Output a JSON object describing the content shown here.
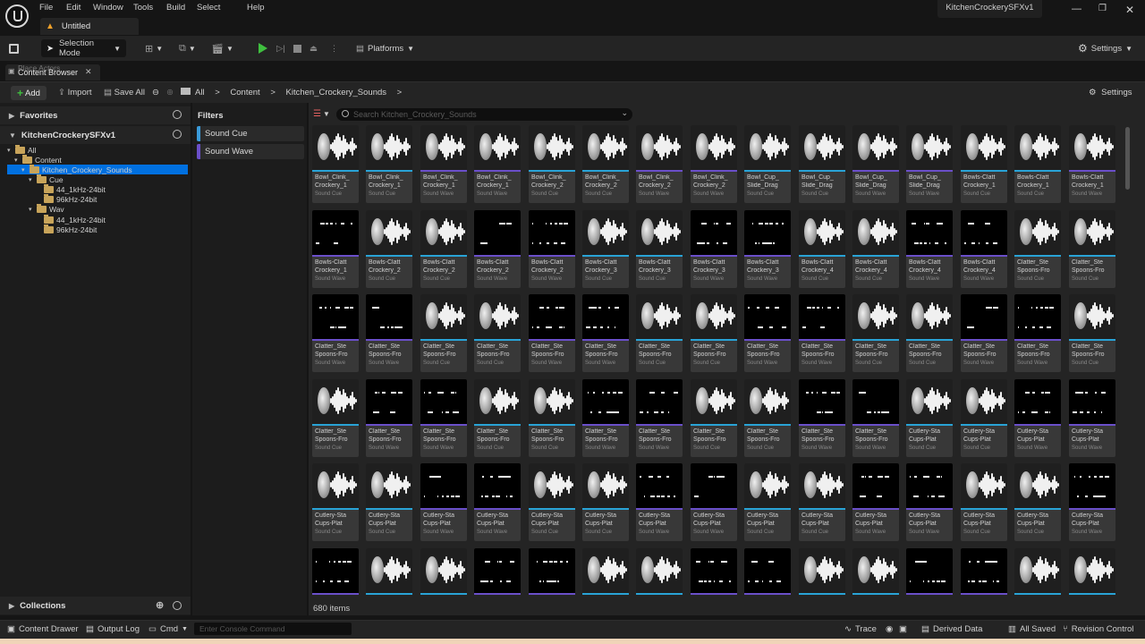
{
  "menu": [
    "File",
    "Edit",
    "Window",
    "Tools",
    "Build",
    "Select",
    "Help"
  ],
  "doc_tab": "Untitled",
  "project_name": "KitchenCrockerySFXv1",
  "toolbar": {
    "selection_mode": "Selection Mode",
    "platforms": "Platforms",
    "settings": "Settings"
  },
  "content_browser": {
    "ghost_tab": "Place Actors",
    "tab": "Content Browser",
    "add": "Add",
    "import": "Import",
    "save_all": "Save All",
    "breadcrumb": [
      "All",
      "Content",
      "Kitchen_Crockery_Sounds"
    ],
    "settings": "Settings"
  },
  "left": {
    "favorites": "Favorites",
    "project": "KitchenCrockerySFXv1",
    "collections": "Collections"
  },
  "tree": [
    {
      "label": "All",
      "level": 0
    },
    {
      "label": "Content",
      "level": 1
    },
    {
      "label": "Kitchen_Crockery_Sounds",
      "level": 2,
      "selected": true
    },
    {
      "label": "Cue",
      "level": 3
    },
    {
      "label": "44_1kHz-24bit",
      "level": 4
    },
    {
      "label": "96kHz-24bit",
      "level": 4
    },
    {
      "label": "Wav",
      "level": 3
    },
    {
      "label": "44_1kHz-24bit",
      "level": 4
    },
    {
      "label": "96kHz-24bit",
      "level": 4
    }
  ],
  "filters": {
    "title": "Filters",
    "items": [
      {
        "label": "Sound Cue",
        "color": "#3a9ad9"
      },
      {
        "label": "Sound Wave",
        "color": "#6a4fc9"
      }
    ]
  },
  "search_placeholder": "Search Kitchen_Crockery_Sounds",
  "item_count": "680 items",
  "type_labels": {
    "cue": "Sound Cue",
    "wave": "Sound Wave"
  },
  "type_colors": {
    "cue": "#29a3d6",
    "wave": "#6a4fc9"
  },
  "assets": [
    [
      [
        "Bowl_Clink_",
        "Crockery_1",
        0,
        0
      ],
      [
        "Bowl_Clink_",
        "Crockery_1",
        0,
        0
      ],
      [
        "Bowl_Clink_",
        "Crockery_1",
        0,
        1
      ],
      [
        "Bowl_Clink_",
        "Crockery_1",
        0,
        1
      ],
      [
        "Bowl_Clink_",
        "Crockery_2",
        0,
        0
      ],
      [
        "Bowl_Clink_",
        "Crockery_2",
        0,
        0
      ],
      [
        "Bowl_Clink_",
        "Crockery_2",
        0,
        1
      ],
      [
        "Bowl_Clink_",
        "Crockery_2",
        0,
        1
      ],
      [
        "Bowl_Cup_",
        "Slide_Drag",
        0,
        0
      ],
      [
        "Bowl_Cup_",
        "Slide_Drag",
        0,
        0
      ],
      [
        "Bowl_Cup_",
        "Slide_Drag",
        0,
        1
      ],
      [
        "Bowl_Cup_",
        "Slide_Drag",
        0,
        1
      ],
      [
        "Bowls-Clatt",
        "Crockery_1",
        0,
        0
      ],
      [
        "Bowls-Clatt",
        "Crockery_1",
        0,
        0
      ],
      [
        "Bowls-Clatt",
        "Crockery_1",
        0,
        1
      ]
    ],
    [
      [
        "Bowls-Clatt",
        "Crockery_1",
        1,
        1
      ],
      [
        "Bowls-Clatt",
        "Crockery_2",
        0,
        0
      ],
      [
        "Bowls-Clatt",
        "Crockery_2",
        0,
        0
      ],
      [
        "Bowls-Clatt",
        "Crockery_2",
        1,
        1
      ],
      [
        "Bowls-Clatt",
        "Crockery_2",
        1,
        1
      ],
      [
        "Bowls-Clatt",
        "Crockery_3",
        0,
        0
      ],
      [
        "Bowls-Clatt",
        "Crockery_3",
        0,
        0
      ],
      [
        "Bowls-Clatt",
        "Crockery_3",
        1,
        1
      ],
      [
        "Bowls-Clatt",
        "Crockery_3",
        1,
        1
      ],
      [
        "Bowls-Clatt",
        "Crockery_4",
        0,
        0
      ],
      [
        "Bowls-Clatt",
        "Crockery_4",
        0,
        0
      ],
      [
        "Bowls-Clatt",
        "Crockery_4",
        1,
        1
      ],
      [
        "Bowls-Clatt",
        "Crockery_4",
        1,
        1
      ],
      [
        "Clatter_Ste",
        "Spoons-Fro",
        0,
        0
      ],
      [
        "Clatter_Ste",
        "Spoons-Fro",
        0,
        0
      ]
    ],
    [
      [
        "Clatter_Ste",
        "Spoons-Fro",
        1,
        1
      ],
      [
        "Clatter_Ste",
        "Spoons-Fro",
        1,
        1
      ],
      [
        "Clatter_Ste",
        "Spoons-Fro",
        0,
        0
      ],
      [
        "Clatter_Ste",
        "Spoons-Fro",
        0,
        0
      ],
      [
        "Clatter_Ste",
        "Spoons-Fro",
        1,
        1
      ],
      [
        "Clatter_Ste",
        "Spoons-Fro",
        1,
        1
      ],
      [
        "Clatter_Ste",
        "Spoons-Fro",
        0,
        0
      ],
      [
        "Clatter_Ste",
        "Spoons-Fro",
        0,
        0
      ],
      [
        "Clatter_Ste",
        "Spoons-Fro",
        1,
        1
      ],
      [
        "Clatter_Ste",
        "Spoons-Fro",
        1,
        1
      ],
      [
        "Clatter_Ste",
        "Spoons-Fro",
        0,
        0
      ],
      [
        "Clatter_Ste",
        "Spoons-Fro",
        0,
        0
      ],
      [
        "Clatter_Ste",
        "Spoons-Fro",
        1,
        1
      ],
      [
        "Clatter_Ste",
        "Spoons-Fro",
        1,
        1
      ],
      [
        "Clatter_Ste",
        "Spoons-Fro",
        0,
        0
      ]
    ],
    [
      [
        "Clatter_Ste",
        "Spoons-Fro",
        0,
        0
      ],
      [
        "Clatter_Ste",
        "Spoons-Fro",
        1,
        1
      ],
      [
        "Clatter_Ste",
        "Spoons-Fro",
        1,
        1
      ],
      [
        "Clatter_Ste",
        "Spoons-Fro",
        0,
        0
      ],
      [
        "Clatter_Ste",
        "Spoons-Fro",
        0,
        0
      ],
      [
        "Clatter_Ste",
        "Spoons-Fro",
        1,
        1
      ],
      [
        "Clatter_Ste",
        "Spoons-Fro",
        1,
        1
      ],
      [
        "Clatter_Ste",
        "Spoons-Fro",
        0,
        0
      ],
      [
        "Clatter_Ste",
        "Spoons-Fro",
        0,
        0
      ],
      [
        "Clatter_Ste",
        "Spoons-Fro",
        1,
        1
      ],
      [
        "Clatter_Ste",
        "Spoons-Fro",
        1,
        1
      ],
      [
        "Cutlery-Sta",
        "Cups-Plat",
        0,
        0
      ],
      [
        "Cutlery-Sta",
        "Cups-Plat",
        0,
        0
      ],
      [
        "Cutlery-Sta",
        "Cups-Plat",
        1,
        1
      ],
      [
        "Cutlery-Sta",
        "Cups-Plat",
        1,
        1
      ]
    ],
    [
      [
        "Cutlery-Sta",
        "Cups-Plat",
        0,
        0
      ],
      [
        "Cutlery-Sta",
        "Cups-Plat",
        0,
        0
      ],
      [
        "Cutlery-Sta",
        "Cups-Plat",
        1,
        1
      ],
      [
        "Cutlery-Sta",
        "Cups-Plat",
        1,
        1
      ],
      [
        "Cutlery-Sta",
        "Cups-Plat",
        0,
        0
      ],
      [
        "Cutlery-Sta",
        "Cups-Plat",
        0,
        0
      ],
      [
        "Cutlery-Sta",
        "Cups-Plat",
        1,
        1
      ],
      [
        "Cutlery-Sta",
        "Cups-Plat",
        1,
        1
      ],
      [
        "Cutlery-Sta",
        "Cups-Plat",
        0,
        0
      ],
      [
        "Cutlery-Sta",
        "Cups-Plat",
        0,
        0
      ],
      [
        "Cutlery-Sta",
        "Cups-Plat",
        1,
        1
      ],
      [
        "Cutlery-Sta",
        "Cups-Plat",
        1,
        1
      ],
      [
        "Cutlery-Sta",
        "Cups-Plat",
        0,
        0
      ],
      [
        "Cutlery-Sta",
        "Cups-Plat",
        0,
        0
      ],
      [
        "Cutlery-Sta",
        "Cups-Plat",
        1,
        1
      ]
    ],
    [
      [
        "",
        "",
        1,
        1
      ],
      [
        "",
        "",
        0,
        0
      ],
      [
        "",
        "",
        0,
        0
      ],
      [
        "",
        "",
        1,
        1
      ],
      [
        "",
        "",
        1,
        1
      ],
      [
        "",
        "",
        0,
        0
      ],
      [
        "",
        "",
        0,
        0
      ],
      [
        "",
        "",
        1,
        1
      ],
      [
        "",
        "",
        1,
        1
      ],
      [
        "",
        "",
        0,
        0
      ],
      [
        "",
        "",
        0,
        0
      ],
      [
        "",
        "",
        1,
        1
      ],
      [
        "",
        "",
        1,
        1
      ],
      [
        "",
        "",
        0,
        0
      ],
      [
        "",
        "",
        0,
        0
      ]
    ]
  ],
  "status": {
    "content_drawer": "Content Drawer",
    "output_log": "Output Log",
    "cmd": "Cmd",
    "console_placeholder": "Enter Console Command",
    "trace": "Trace",
    "derived_data": "Derived Data",
    "all_saved": "All Saved",
    "revision_control": "Revision Control"
  }
}
